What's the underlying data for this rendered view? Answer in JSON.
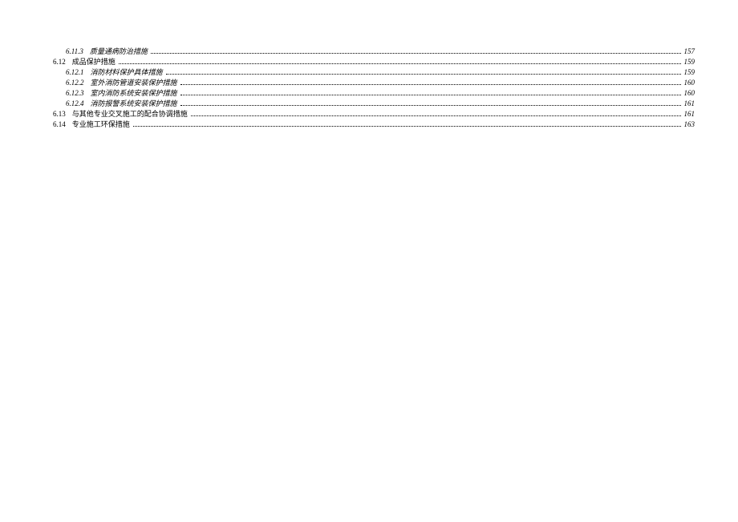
{
  "toc": [
    {
      "style": "italic",
      "indent": 1,
      "num": "6.11.3",
      "title": "质量通病防治措施",
      "page": "157"
    },
    {
      "style": "normal",
      "indent": 0,
      "num": "6.12",
      "title": "成品保护措施",
      "page": "159"
    },
    {
      "style": "italic",
      "indent": 1,
      "num": "6.12.1",
      "title": "消防材料保护具体措施",
      "page": "159"
    },
    {
      "style": "italic",
      "indent": 1,
      "num": "6.12.2",
      "title": "室外消防管道安装保护措施",
      "page": "160"
    },
    {
      "style": "italic",
      "indent": 1,
      "num": "6.12.3",
      "title": "室内消防系统安装保护措施",
      "page": "160"
    },
    {
      "style": "italic",
      "indent": 1,
      "num": "6.12.4",
      "title": "消防报警系统安装保护措施",
      "page": "161"
    },
    {
      "style": "normal",
      "indent": 0,
      "num": "6.13",
      "title": "与其他专业交叉施工的配合协调措施",
      "page": "161"
    },
    {
      "style": "normal",
      "indent": 0,
      "num": "6.14",
      "title": "专业施工环保措施",
      "page": "163"
    }
  ]
}
